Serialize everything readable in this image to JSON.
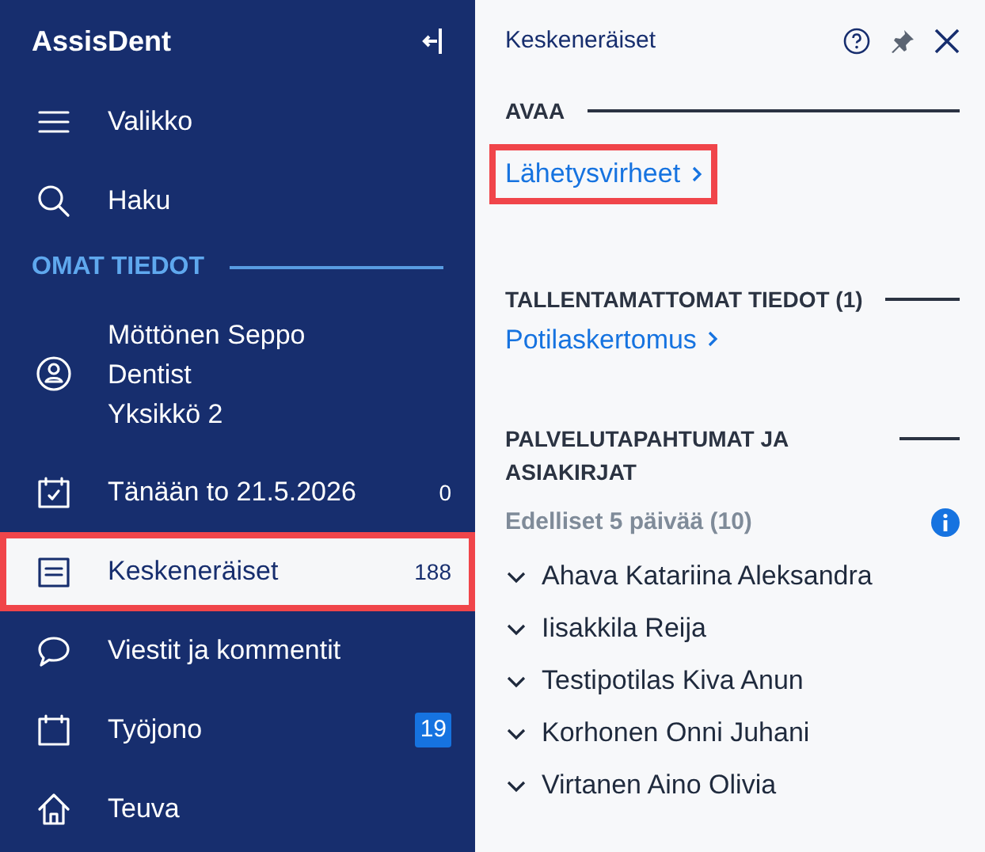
{
  "sidebar": {
    "app_title": "AssisDent",
    "sections": [
      {
        "items": [
          {
            "kind": "nav",
            "label": "Valikko",
            "selected": false,
            "highlighted": false
          },
          {
            "kind": "nav",
            "label": "Haku",
            "selected": false,
            "highlighted": false
          }
        ]
      },
      {
        "heading": "OMAT TIEDOT",
        "items": [
          {
            "kind": "user",
            "lines": [
              "Möttönen Seppo",
              "Dentist",
              "Yksikkö 2"
            ],
            "selected": false,
            "highlighted": false
          },
          {
            "kind": "nav",
            "label": "Tänään to 21.5.2026",
            "count": "0",
            "count_badge": false,
            "selected": false,
            "highlighted": false
          },
          {
            "kind": "nav",
            "label": "Keskeneräiset",
            "count": "188",
            "count_badge": false,
            "selected": true,
            "highlighted": true
          },
          {
            "kind": "nav",
            "label": "Viestit ja kommentit",
            "selected": false,
            "highlighted": false
          },
          {
            "kind": "nav",
            "label": "Työjono",
            "count": "19",
            "count_badge": true,
            "selected": false,
            "highlighted": false
          },
          {
            "kind": "nav",
            "label": "Teuva",
            "selected": false,
            "highlighted": false
          }
        ]
      }
    ]
  },
  "panel": {
    "title": "Keskeneräiset",
    "sections": [
      {
        "heading": "AVAA",
        "links": [
          {
            "label": "Lähetysvirheet",
            "highlighted": true
          }
        ]
      },
      {
        "heading": "TALLENTAMATTOMAT TIEDOT (1)",
        "links": [
          {
            "label": "Potilaskertomus",
            "highlighted": false
          }
        ]
      },
      {
        "heading": "PALVELUTAPAHTUMAT JA ASIAKIRJAT",
        "subheading": "Edelliset 5 päivää (10)",
        "patients": [
          {
            "name": "Ahava Katariina Aleksandra",
            "expanded": false
          },
          {
            "name": "Iisakkila Reija",
            "expanded": false
          },
          {
            "name": "Testipotilas Kiva Anun",
            "expanded": false
          },
          {
            "name": "Korhonen Onni Juhani",
            "expanded": false
          },
          {
            "name": "Virtanen Aino Olivia",
            "expanded": false
          }
        ]
      }
    ]
  }
}
